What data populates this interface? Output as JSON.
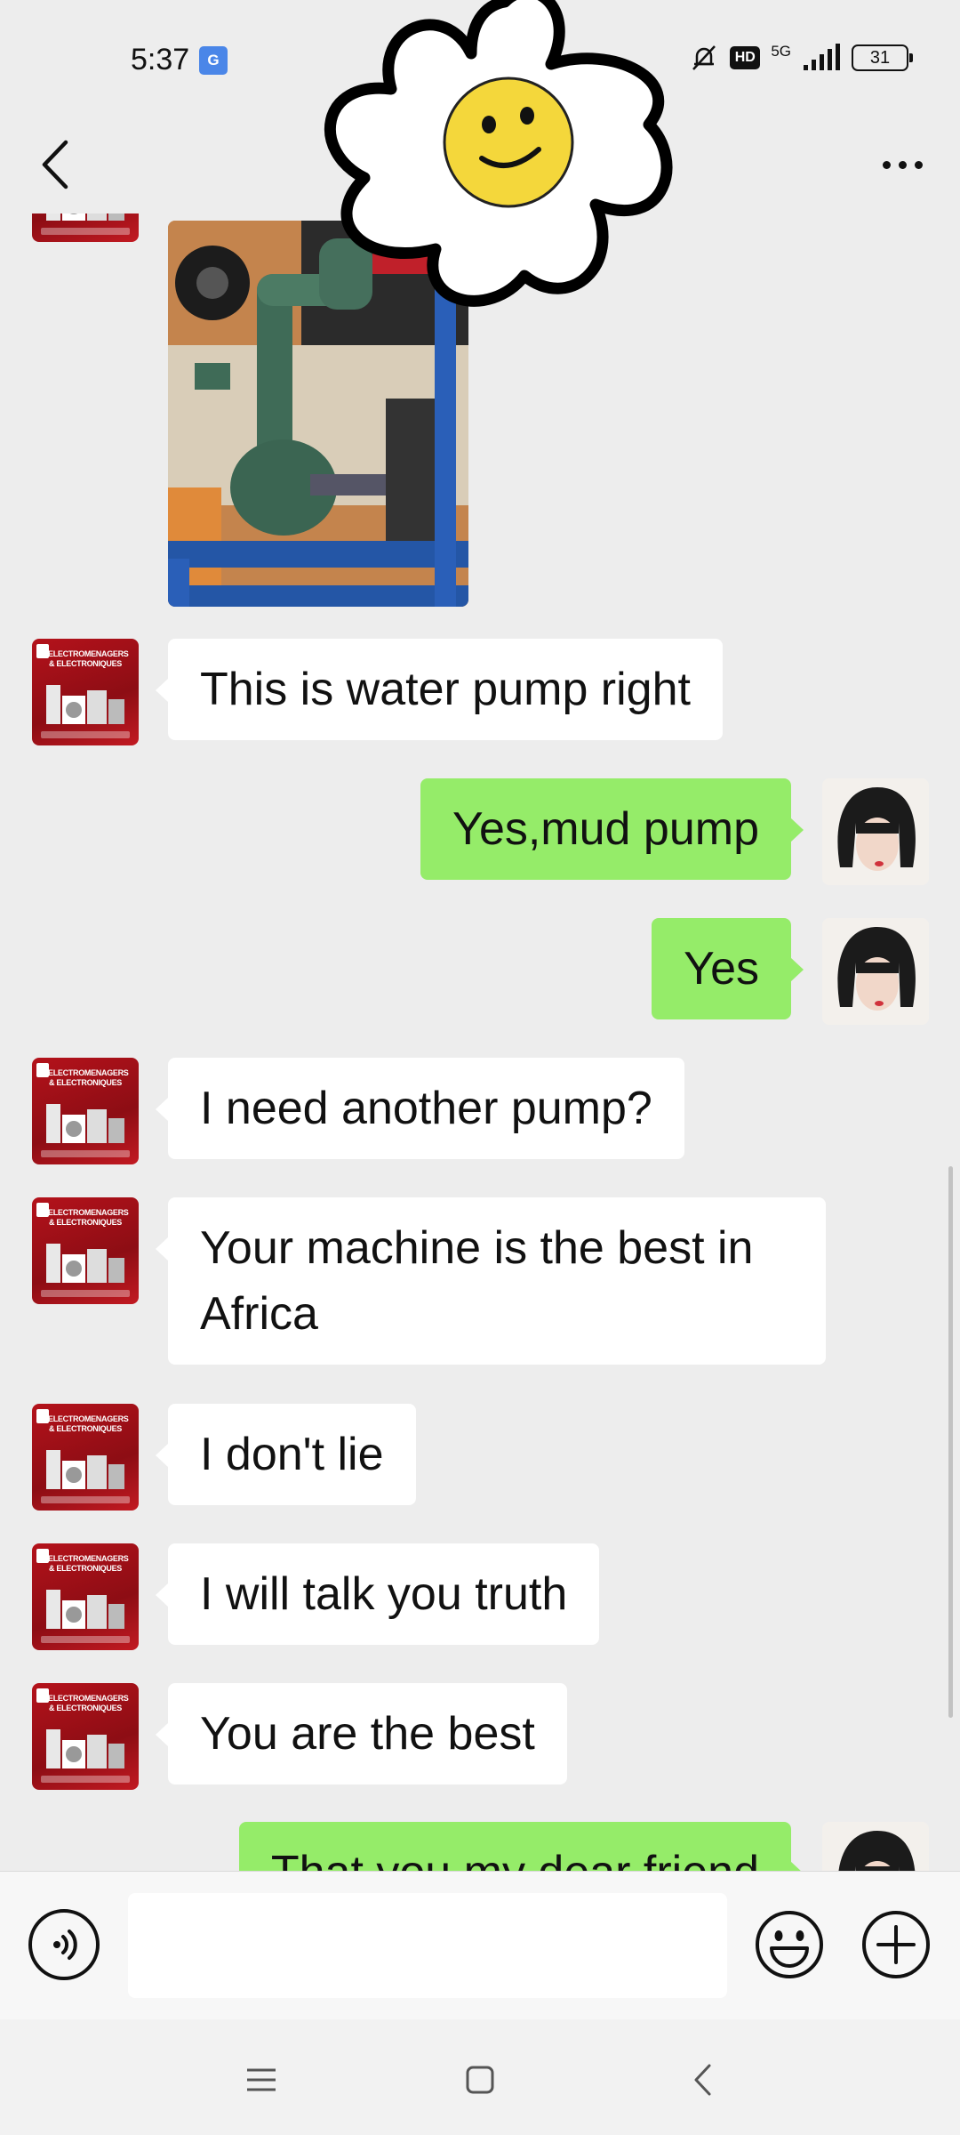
{
  "status_bar": {
    "time": "5:37",
    "translate_badge": "G",
    "hd_label": "HD",
    "network": "5G",
    "battery": "31"
  },
  "header": {
    "back_icon": "chevron-left-icon",
    "more_icon": "more-dots-icon"
  },
  "messages": [
    {
      "side": "in",
      "type": "image",
      "description_icon": "photo-icon"
    },
    {
      "side": "in",
      "text": "This is water pump right"
    },
    {
      "side": "out",
      "text": "Yes,mud pump"
    },
    {
      "side": "out",
      "text": "Yes"
    },
    {
      "side": "in",
      "text": "I need another pump?"
    },
    {
      "side": "in",
      "text": "Your machine is the best in Africa"
    },
    {
      "side": "in",
      "text": "I don't lie"
    },
    {
      "side": "in",
      "text": "I will talk you truth"
    },
    {
      "side": "in",
      "text": "You are the best"
    },
    {
      "side": "out",
      "text": "That you my dear friend"
    }
  ],
  "shop_avatar": {
    "line1": "ELECTROMENAGERS",
    "line2": "& ELECTRONIQUES"
  },
  "input_bar": {
    "value": "",
    "voice_icon": "voice-icon",
    "emoji_icon": "emoji-icon",
    "plus_icon": "plus-icon"
  },
  "colors": {
    "background": "#ededed",
    "bubble_in": "#ffffff",
    "bubble_out": "#95ec69",
    "input_bar": "#f7f7f7"
  }
}
